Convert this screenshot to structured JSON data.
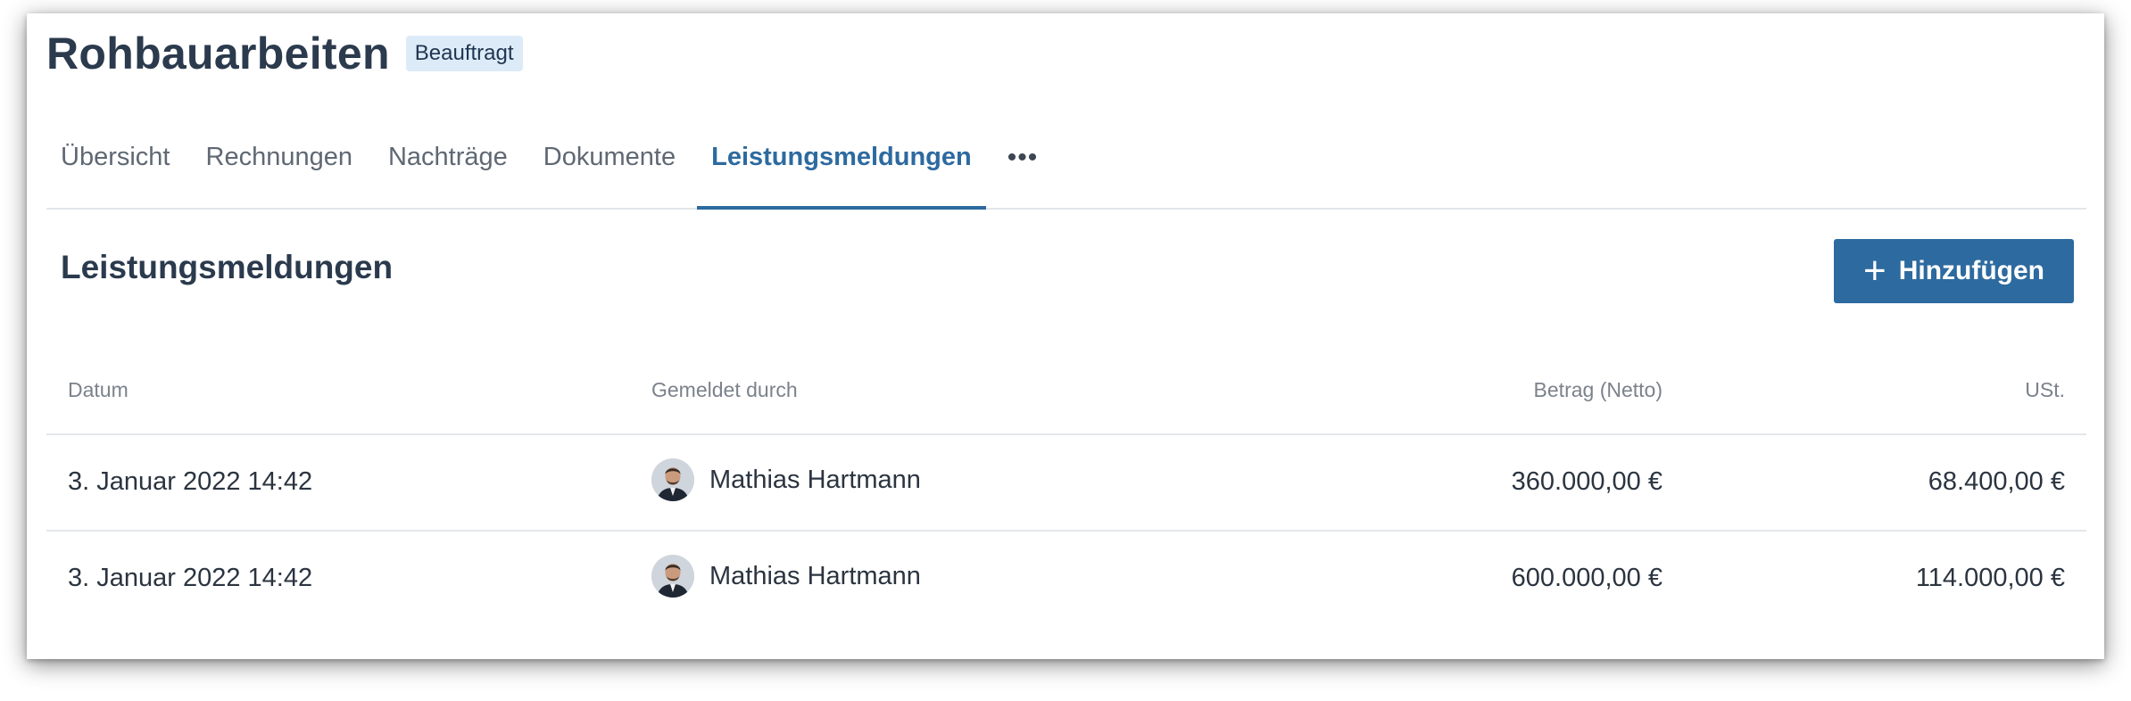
{
  "header": {
    "title": "Rohbauarbeiten",
    "status_badge": "Beauftragt"
  },
  "tabs": [
    {
      "label": "Übersicht",
      "active": false
    },
    {
      "label": "Rechnungen",
      "active": false
    },
    {
      "label": "Nachträge",
      "active": false
    },
    {
      "label": "Dokumente",
      "active": false
    },
    {
      "label": "Leistungsmeldungen",
      "active": true
    }
  ],
  "tabs_more": "•••",
  "section": {
    "title": "Leistungsmeldungen",
    "add_button_label": "Hinzufügen",
    "add_icon": "+"
  },
  "table": {
    "columns": [
      "Datum",
      "Gemeldet durch",
      "Betrag (Netto)",
      "USt."
    ],
    "rows": [
      {
        "date": "3. Januar 2022 14:42",
        "reporter": "Mathias Hartmann",
        "amount_net": "360.000,00 €",
        "vat": "68.400,00 €"
      },
      {
        "date": "3. Januar 2022 14:42",
        "reporter": "Mathias Hartmann",
        "amount_net": "600.000,00 €",
        "vat": "114.000,00 €"
      }
    ]
  },
  "colors": {
    "accent": "#2d6a9f",
    "badge_bg": "#ddebf8",
    "title": "#2b3a4d"
  }
}
